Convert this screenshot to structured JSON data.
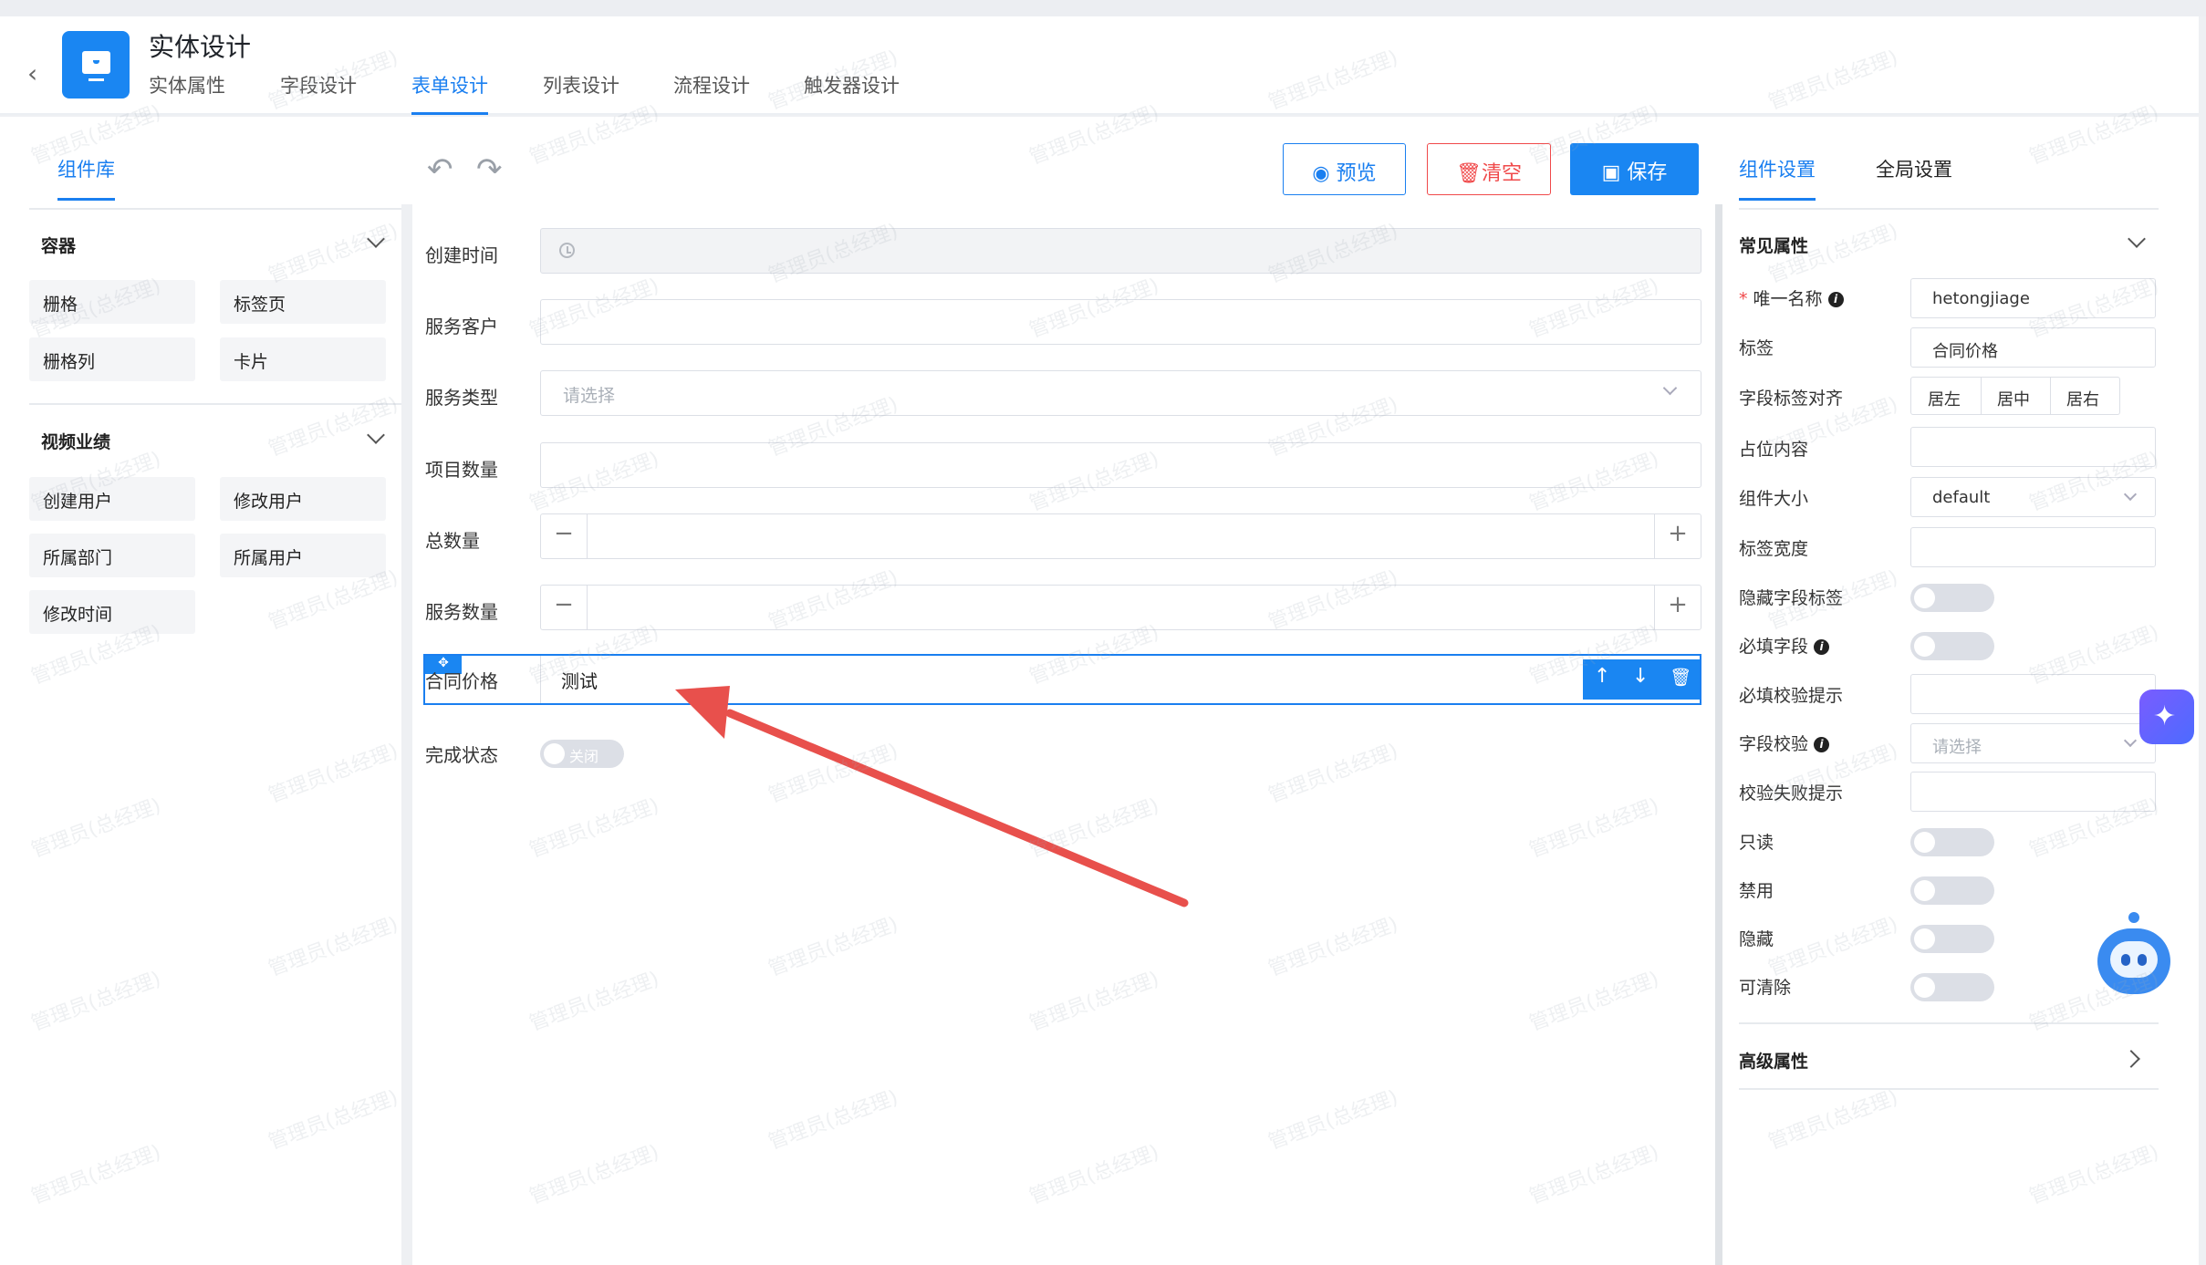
{
  "header": {
    "title": "实体设计",
    "tabs": [
      "实体属性",
      "字段设计",
      "表单设计",
      "列表设计",
      "流程设计",
      "触发器设计"
    ],
    "active_tab": 2
  },
  "left_panel": {
    "tab": "组件库",
    "groups": [
      {
        "title": "容器",
        "items": [
          "栅格",
          "标签页",
          "栅格列",
          "卡片"
        ]
      },
      {
        "title": "视频业绩",
        "items": [
          "创建用户",
          "修改用户",
          "所属部门",
          "所属用户",
          "修改时间"
        ]
      }
    ]
  },
  "toolbar": {
    "undo_icon": "undo-icon",
    "redo_icon": "redo-icon",
    "preview": "预览",
    "clear": "清空",
    "save": "保存"
  },
  "form": {
    "fields": [
      {
        "label": "创建时间",
        "type": "datetime",
        "value": ""
      },
      {
        "label": "服务客户",
        "type": "input",
        "value": ""
      },
      {
        "label": "服务类型",
        "type": "select",
        "placeholder": "请选择"
      },
      {
        "label": "项目数量",
        "type": "input",
        "value": ""
      },
      {
        "label": "总数量",
        "type": "stepper",
        "minus": "−",
        "plus": "+"
      },
      {
        "label": "服务数量",
        "type": "stepper",
        "minus": "−",
        "plus": "+"
      },
      {
        "label": "合同价格",
        "type": "input",
        "value": "测试",
        "selected": true
      },
      {
        "label": "完成状态",
        "type": "switch",
        "switch_text": "关闭"
      }
    ],
    "row_actions": {
      "up": "↑",
      "down": "↓"
    }
  },
  "right_panel": {
    "tabs": [
      "组件设置",
      "全局设置"
    ],
    "common_title": "常见属性",
    "props": {
      "unique_name_label": "唯一名称",
      "unique_name_value": "hetongjiage",
      "label_label": "标签",
      "label_value": "合同价格",
      "align_label": "字段标签对齐",
      "align_options": [
        "居左",
        "居中",
        "居右"
      ],
      "placeholder_label": "占位内容",
      "size_label": "组件大小",
      "size_value": "default",
      "label_width_label": "标签宽度",
      "hide_label_label": "隐藏字段标签",
      "required_label": "必填字段",
      "required_msg_label": "必填校验提示",
      "validate_label": "字段校验",
      "validate_placeholder": "请选择",
      "validate_fail_label": "校验失败提示",
      "readonly_label": "只读",
      "disabled_label": "禁用",
      "hidden_label": "隐藏",
      "clearable_label": "可清除"
    },
    "advanced_title": "高级属性"
  },
  "watermark": "管理员(总经理)",
  "colors": {
    "accent": "#1a7ff0",
    "danger": "#f0494a",
    "arrow": "#e8504c"
  }
}
